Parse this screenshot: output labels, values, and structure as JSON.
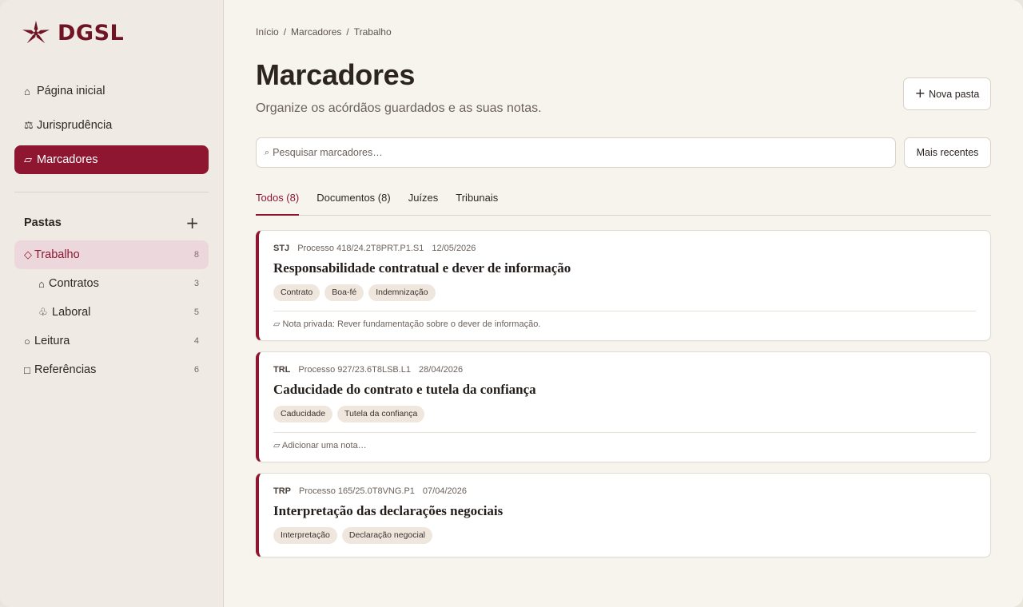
{
  "brand": {
    "name": "DGSL",
    "color": "#6e1424"
  },
  "colors": {
    "accent": "#8e1630",
    "sidebar_bg": "#efeae3",
    "main_bg": "#f7f4ee"
  },
  "nav": [
    {
      "glyph": "⌂",
      "icon": "home-icon",
      "label": "Página inicial",
      "active": false
    },
    {
      "glyph": "⚖",
      "icon": "scales-icon",
      "label": "Jurisprudência",
      "active": false
    },
    {
      "glyph": "▱",
      "icon": "bookmark-icon",
      "label": "Marcadores",
      "active": true
    }
  ],
  "folders": {
    "title": "Pastas",
    "add_glyph": "+",
    "items": [
      {
        "glyph": "◇",
        "icon": "diamond-icon",
        "label": "Trabalho",
        "count": "8",
        "selected": true,
        "sub": false
      },
      {
        "glyph": "⌂",
        "icon": "house-icon",
        "label": "Contratos",
        "count": "3",
        "selected": false,
        "sub": true
      },
      {
        "glyph": "♧",
        "icon": "club-icon",
        "label": "Laboral",
        "count": "5",
        "selected": false,
        "sub": true
      },
      {
        "glyph": "○",
        "icon": "circle-icon",
        "label": "Leitura",
        "count": "4",
        "selected": false,
        "sub": false
      },
      {
        "glyph": "□",
        "icon": "square-icon",
        "label": "Referências",
        "count": "6",
        "selected": false,
        "sub": false
      }
    ]
  },
  "breadcrumb": [
    "Início",
    "Marcadores",
    "Trabalho"
  ],
  "breadcrumb_sep": "/",
  "header": {
    "title": "Marcadores",
    "subtitle": "Organize os acórdãos guardados e as suas notas.",
    "new_folder_glyph": "+",
    "new_folder_label": "Nova pasta"
  },
  "search": {
    "glyph": "⌕",
    "placeholder": "Pesquisar marcadores…",
    "value": ""
  },
  "sort_label": "Mais recentes",
  "tabs": [
    {
      "label": "Todos (8)",
      "active": true
    },
    {
      "label": "Documentos (8)",
      "active": false
    },
    {
      "label": "Juízes",
      "active": false
    },
    {
      "label": "Tribunais",
      "active": false
    }
  ],
  "bookmarks": [
    {
      "court": "STJ",
      "process": "Processo 418/24.2T8PRT.P1.S1",
      "date": "12/05/2026",
      "title": "Responsabilidade contratual e dever de informação",
      "tags": [
        "Contrato",
        "Boa-fé",
        "Indemnização"
      ],
      "note": "▱ Nota privada: Rever fundamentação sobre o dever de informação."
    },
    {
      "court": "TRL",
      "process": "Processo 927/23.6T8LSB.L1",
      "date": "28/04/2026",
      "title": "Caducidade do contrato e tutela da confiança",
      "tags": [
        "Caducidade",
        "Tutela da confiança"
      ],
      "note": "▱ Adicionar uma nota…"
    },
    {
      "court": "TRP",
      "process": "Processo 165/25.0T8VNG.P1",
      "date": "07/04/2026",
      "title": "Interpretação das declarações negociais",
      "tags": [
        "Interpretação",
        "Declaração negocial"
      ],
      "note": null
    }
  ]
}
